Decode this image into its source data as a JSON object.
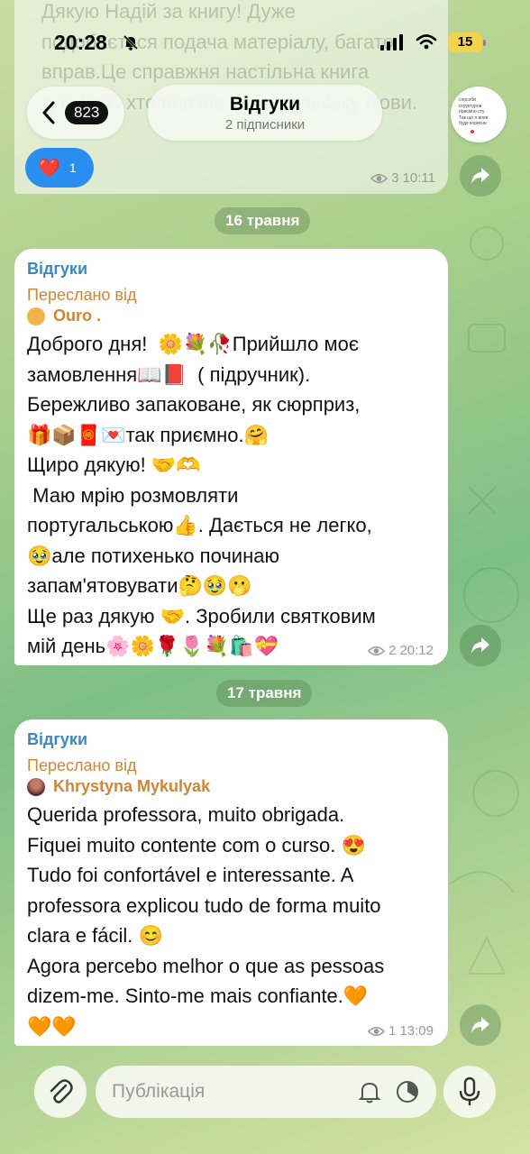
{
  "status": {
    "time": "20:28",
    "battery": "15"
  },
  "header": {
    "back_count": "823",
    "title": "Відгуки",
    "subtitle": "2 підписники"
  },
  "avatar_text": [
    "способи",
    "структуров",
    "приємно сту",
    "Так що я впев",
    "буде корисни"
  ],
  "prev_message": {
    "faded_text": "Дякую Надій за книгу! Дуже\nподобається подача матеріалу, багато\nвправ.Це справжня настільна книга\nдля всіх, хто вивчає португальську мови.",
    "reaction_emoji": "❤️",
    "reaction_count": "1",
    "views": "3",
    "time": "10:11"
  },
  "date1": "16 травня",
  "msg1": {
    "sender": "Відгуки",
    "forwarded_label": "Переслано від",
    "from": "Ouro .",
    "text": "Доброго дня!  🌼💐🥀Прийшло моє\nзамовлення📖📕  ( підручник).\nБережливо запаковане, як сюрприз,\n🎁📦🧧💌так приємно.🤗\nЩиро дякую! 🤝🫶\n Маю мрію розмовляти\nпортугальською👍. Дається не легко,\n🥹але потихенько починаю\nзапам'ятовувати🤔🥹🫢\nЩе раз дякую 🤝. Зробили святковим\nмій день🌸🌼🌹🌷💐🛍️💝",
    "views": "2",
    "time": "20:12"
  },
  "date2": "17 травня",
  "msg2": {
    "sender": "Відгуки",
    "forwarded_label": "Переслано від",
    "from": "Khrystyna Mykulyak",
    "text": "Querida professora, muito obrigada.\nFiquei muito contente com o curso. 😍\nTudo foi confortável e interessante. A\nprofessora explicou tudo de forma muito\nclara e fácil. 😊\nAgora percebo melhor o que as pessoas\ndizem-me. Sinto-me mais confiante.🧡\n🧡🧡",
    "views": "1",
    "time": "13:09"
  },
  "input": {
    "placeholder": "Публікація"
  },
  "colors": {
    "accent": "#3a88c3",
    "forward": "#d08634",
    "reaction": "#2a8ef0"
  }
}
